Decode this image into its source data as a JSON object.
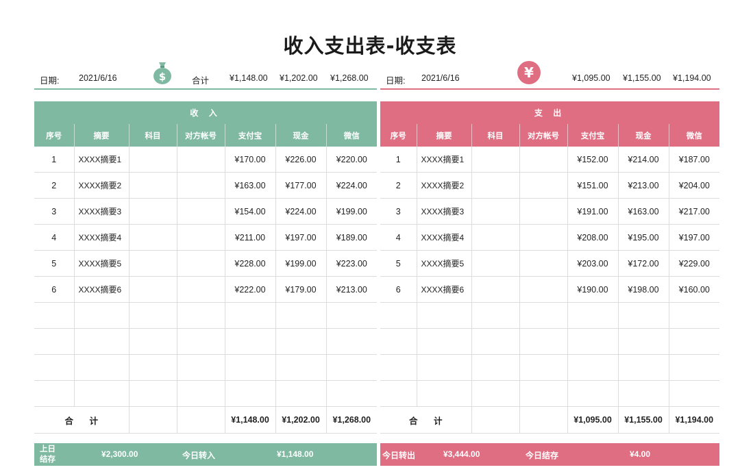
{
  "title": "收入支出表-收支表",
  "colors": {
    "income": "#7fb9a2",
    "expense": "#e06e82"
  },
  "income": {
    "date_label": "日期:",
    "date": "2021/6/16",
    "icon": "money-bag-icon",
    "icon_glyph": "$",
    "total_label": "合计",
    "totals_top": [
      "¥1,148.00",
      "¥1,202.00",
      "¥1,268.00"
    ],
    "band": "收 入",
    "headers": [
      "序号",
      "摘要",
      "科目",
      "对方帐号",
      "支付宝",
      "现金",
      "微信"
    ],
    "rows": [
      [
        "1",
        "XXXX摘要1",
        "",
        "",
        "¥170.00",
        "¥226.00",
        "¥220.00"
      ],
      [
        "2",
        "XXXX摘要2",
        "",
        "",
        "¥163.00",
        "¥177.00",
        "¥224.00"
      ],
      [
        "3",
        "XXXX摘要3",
        "",
        "",
        "¥154.00",
        "¥224.00",
        "¥199.00"
      ],
      [
        "4",
        "XXXX摘要4",
        "",
        "",
        "¥211.00",
        "¥197.00",
        "¥189.00"
      ],
      [
        "5",
        "XXXX摘要5",
        "",
        "",
        "¥228.00",
        "¥199.00",
        "¥223.00"
      ],
      [
        "6",
        "XXXX摘要6",
        "",
        "",
        "¥222.00",
        "¥179.00",
        "¥213.00"
      ],
      [
        "",
        "",
        "",
        "",
        "",
        "",
        ""
      ],
      [
        "",
        "",
        "",
        "",
        "",
        "",
        ""
      ],
      [
        "",
        "",
        "",
        "",
        "",
        "",
        ""
      ],
      [
        "",
        "",
        "",
        "",
        "",
        "",
        ""
      ]
    ],
    "total_row_label": "合 计",
    "totals_bottom": [
      "¥1,148.00",
      "¥1,202.00",
      "¥1,268.00"
    ],
    "footer": {
      "prev_label": "上日结存",
      "prev_value": "¥2,300.00",
      "today_label": "今日转入",
      "today_value": "¥1,148.00"
    }
  },
  "expense": {
    "date_label": "日期:",
    "date": "2021/6/16",
    "icon": "yen-icon",
    "icon_glyph": "¥",
    "totals_top": [
      "¥1,095.00",
      "¥1,155.00",
      "¥1,194.00"
    ],
    "band": "支 出",
    "headers": [
      "序号",
      "摘要",
      "科目",
      "对方帐号",
      "支付宝",
      "现金",
      "微信"
    ],
    "rows": [
      [
        "1",
        "XXXX摘要1",
        "",
        "",
        "¥152.00",
        "¥214.00",
        "¥187.00"
      ],
      [
        "2",
        "XXXX摘要2",
        "",
        "",
        "¥151.00",
        "¥213.00",
        "¥204.00"
      ],
      [
        "3",
        "XXXX摘要3",
        "",
        "",
        "¥191.00",
        "¥163.00",
        "¥217.00"
      ],
      [
        "4",
        "XXXX摘要4",
        "",
        "",
        "¥208.00",
        "¥195.00",
        "¥197.00"
      ],
      [
        "5",
        "XXXX摘要5",
        "",
        "",
        "¥203.00",
        "¥172.00",
        "¥229.00"
      ],
      [
        "6",
        "XXXX摘要6",
        "",
        "",
        "¥190.00",
        "¥198.00",
        "¥160.00"
      ],
      [
        "",
        "",
        "",
        "",
        "",
        "",
        ""
      ],
      [
        "",
        "",
        "",
        "",
        "",
        "",
        ""
      ],
      [
        "",
        "",
        "",
        "",
        "",
        "",
        ""
      ],
      [
        "",
        "",
        "",
        "",
        "",
        "",
        ""
      ]
    ],
    "total_row_label": "合 计",
    "totals_bottom": [
      "¥1,095.00",
      "¥1,155.00",
      "¥1,194.00"
    ],
    "footer": {
      "out_label": "今日转出",
      "out_value": "¥3,444.00",
      "bal_label": "今日结存",
      "bal_value": "¥4.00"
    }
  }
}
